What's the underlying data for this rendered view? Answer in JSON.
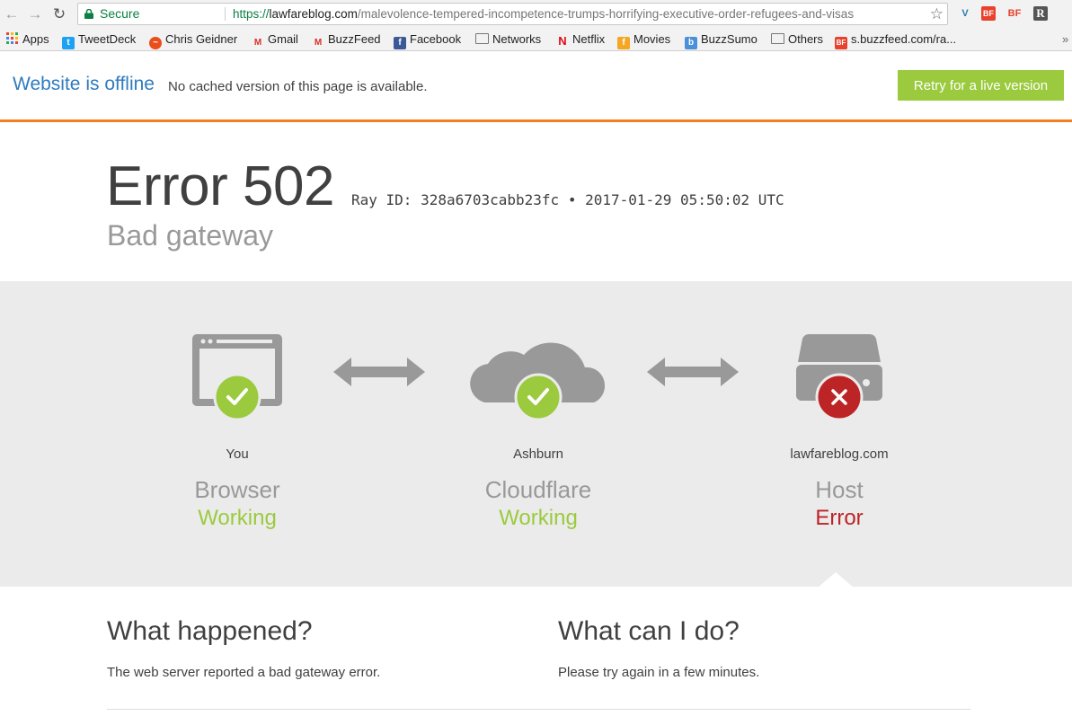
{
  "browser": {
    "secure_label": "Secure",
    "url_scheme": "https://",
    "url_host": "lawfareblog.com",
    "url_path": "/malevolence-tempered-incompetence-trumps-horrifying-executive-order-refugees-and-visas",
    "extensions": [
      "V",
      "BF",
      "BF",
      "R"
    ]
  },
  "bookmarks": [
    {
      "label": "Apps",
      "icon": "apps-grid-icon"
    },
    {
      "label": "TweetDeck",
      "icon": "tweetdeck-icon"
    },
    {
      "label": "Chris Geidner",
      "icon": "chris-geidner-icon"
    },
    {
      "label": "Gmail",
      "icon": "gmail-icon"
    },
    {
      "label": "BuzzFeed",
      "icon": "buzzfeed-gmail-icon"
    },
    {
      "label": "Facebook",
      "icon": "facebook-icon"
    },
    {
      "label": "Networks",
      "icon": "folder-icon"
    },
    {
      "label": "Netflix",
      "icon": "netflix-icon"
    },
    {
      "label": "Movies",
      "icon": "movies-icon"
    },
    {
      "label": "BuzzSumo",
      "icon": "buzzsumo-icon"
    },
    {
      "label": "Others",
      "icon": "folder-icon"
    },
    {
      "label": "s.buzzfeed.com/ra...",
      "icon": "bf-icon"
    }
  ],
  "overflow_label": "»",
  "offline_bar": {
    "title": "Website is offline",
    "message": "No cached version of this page is available.",
    "retry_label": "Retry for a live version"
  },
  "error": {
    "code": "Error 502",
    "ray": "Ray ID: 328a6703cabb23fc • 2017-01-29 05:50:02 UTC",
    "title": "Bad gateway"
  },
  "status": [
    {
      "location": "You",
      "name": "Browser",
      "state": "Working",
      "ok": true
    },
    {
      "location": "Ashburn",
      "name": "Cloudflare",
      "state": "Working",
      "ok": true
    },
    {
      "location": "lawfareblog.com",
      "name": "Host",
      "state": "Error",
      "ok": false
    }
  ],
  "what_happened": {
    "heading": "What happened?",
    "text": "The web server reported a bad gateway error."
  },
  "what_can_i_do": {
    "heading": "What can I do?",
    "text": "Please try again in a few minutes."
  },
  "colors": {
    "accent_orange": "#f38020",
    "ok_green": "#9bca3e",
    "error_red": "#bd2426",
    "link_blue": "#2f7bbf"
  }
}
